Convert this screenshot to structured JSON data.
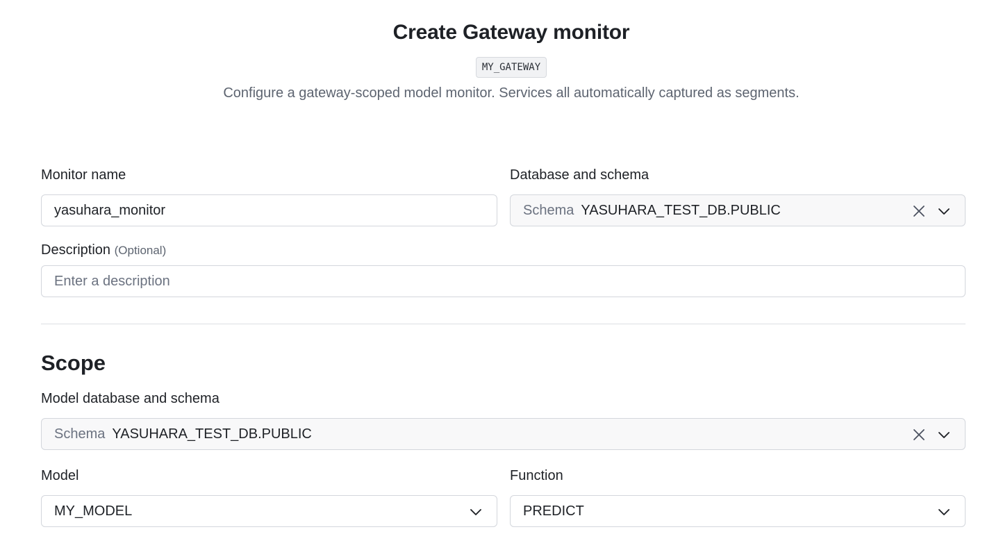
{
  "header": {
    "title": "Create Gateway monitor",
    "gateway_badge": "MY_GATEWAY",
    "subtitle": "Configure a gateway-scoped model monitor. Services all automatically captured as segments."
  },
  "monitor_name": {
    "label": "Monitor name",
    "value": "yasuhara_monitor"
  },
  "database_schema": {
    "label": "Database and schema",
    "prefix": "Schema",
    "value": "YASUHARA_TEST_DB.PUBLIC",
    "icons": [
      "close-icon",
      "chevron-down-icon"
    ]
  },
  "description": {
    "label": "Description",
    "optional": "(Optional)",
    "placeholder": "Enter a description"
  },
  "scope": {
    "heading": "Scope",
    "model_schema": {
      "label": "Model database and schema",
      "prefix": "Schema",
      "value": "YASUHARA_TEST_DB.PUBLIC"
    },
    "model": {
      "label": "Model",
      "value": "MY_MODEL"
    },
    "function": {
      "label": "Function",
      "value": "PREDICT"
    }
  }
}
